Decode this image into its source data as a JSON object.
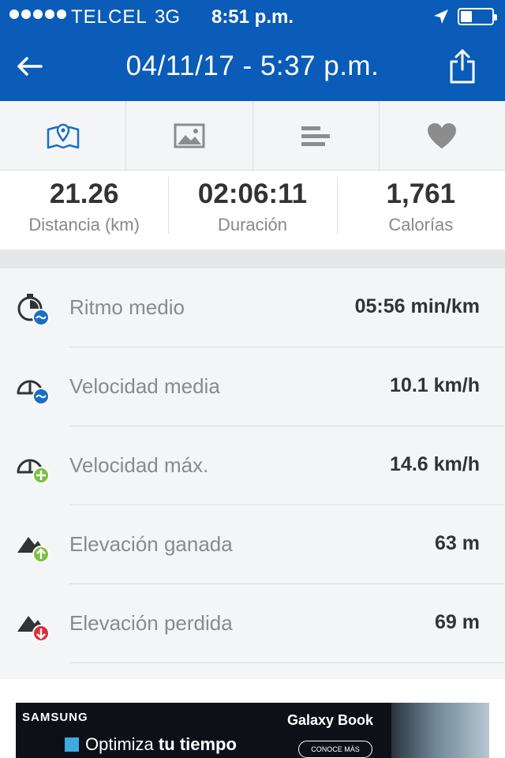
{
  "status_bar": {
    "carrier": "TELCEL",
    "network": "3G",
    "time": "8:51 p.m.",
    "signal_bars": 5
  },
  "nav": {
    "title": "04/11/17 - 5:37 p.m.",
    "back_icon": "arrow-left-icon",
    "share_icon": "share-icon"
  },
  "tabs": [
    {
      "icon": "map-icon",
      "active": true
    },
    {
      "icon": "image-icon",
      "active": false
    },
    {
      "icon": "bars-icon",
      "active": false
    },
    {
      "icon": "heart-icon",
      "active": false
    }
  ],
  "summary": [
    {
      "value": "21.26",
      "label": "Distancia (km)"
    },
    {
      "value": "02:06:11",
      "label": "Duración"
    },
    {
      "value": "1,761",
      "label": "Calorías"
    }
  ],
  "metrics": [
    {
      "name": "Ritmo medio",
      "value": "05:56 min/km",
      "icon": "stopwatch-pace-icon"
    },
    {
      "name": "Velocidad media",
      "value": "10.1 km/h",
      "icon": "speedometer-average-icon"
    },
    {
      "name": "Velocidad máx.",
      "value": "14.6 km/h",
      "icon": "speedometer-max-icon"
    },
    {
      "name": "Elevación ganada",
      "value": "63 m",
      "icon": "elevation-up-icon"
    },
    {
      "name": "Elevación perdida",
      "value": "69 m",
      "icon": "elevation-down-icon"
    }
  ],
  "ad": {
    "brand": "SAMSUNG",
    "tagline_1": "Optimiza",
    "tagline_2": "tu tiempo",
    "product": "Galaxy Book",
    "cta": "CONOCE MÁS"
  },
  "colors": {
    "brand_blue": "#0a5cb8",
    "active_tab": "#1a6fc4",
    "inactive_tab": "#8c8c8c",
    "plus_green": "#7bc043",
    "down_red": "#d9303a"
  }
}
